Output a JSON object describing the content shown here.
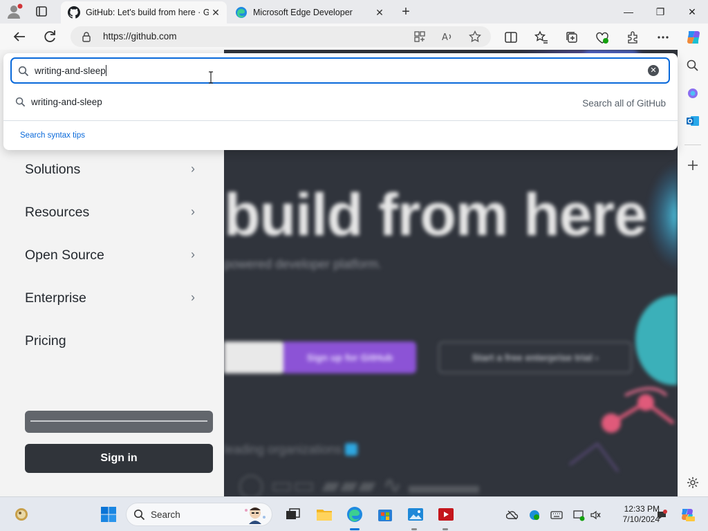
{
  "browser": {
    "tabs": [
      {
        "title": "GitHub: Let's build from here · GitHub",
        "active": true,
        "icon": "github-icon"
      },
      {
        "title": "Microsoft Edge Developer",
        "active": false,
        "icon": "edge-icon"
      }
    ],
    "close_glyph": "✕",
    "new_tab_glyph": "+",
    "window_controls": {
      "minimize": "—",
      "restore": "❐",
      "close": "✕"
    },
    "url": "https://github.com"
  },
  "search": {
    "query": "writing-and-sleep",
    "suggestion": "writing-and-sleep",
    "search_all_label": "Search all of GitHub",
    "tips_label": "Search syntax tips",
    "clear_glyph": "✕"
  },
  "nav_menu": {
    "items": [
      {
        "label": "Solutions",
        "has_chevron": true
      },
      {
        "label": "Resources",
        "has_chevron": true
      },
      {
        "label": "Open Source",
        "has_chevron": true
      },
      {
        "label": "Enterprise",
        "has_chevron": true
      },
      {
        "label": "Pricing",
        "has_chevron": false
      }
    ],
    "chevron_glyph": "›",
    "sign_in_label": "Sign in"
  },
  "hero": {
    "title": "build from here",
    "subtitle": "powered developer platform.",
    "signup_label": "Sign up for GitHub",
    "trial_label": "Start a free enterprise trial ›",
    "trusted_label": "leading organizations"
  },
  "taskbar": {
    "search_label": "Search",
    "time": "12:33 PM",
    "date": "7/10/2024"
  },
  "colors": {
    "accent": "#0969da",
    "signup_purple": "#8c53d6",
    "hero_bg": "#30343c",
    "signin_bg": "#30343a"
  }
}
